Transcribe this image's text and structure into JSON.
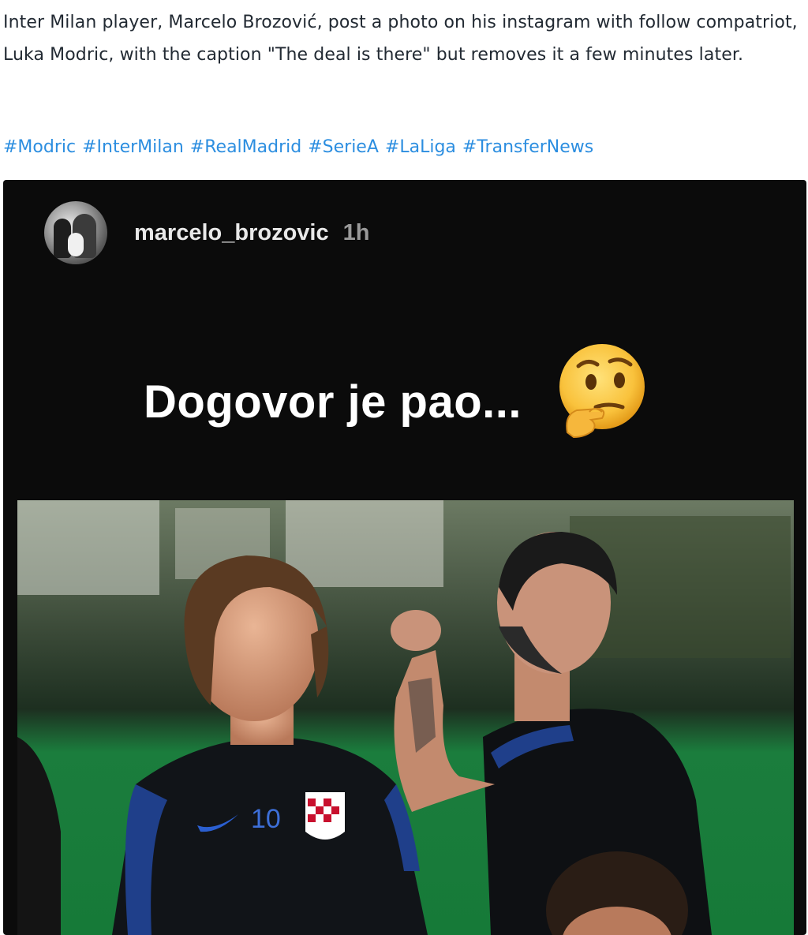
{
  "post": {
    "text": "Inter Milan player, Marcelo Brozović, post a photo on his instagram with follow compatriot, Luka Modric, with the caption \"The deal is there\" but removes it a few minutes later.",
    "hashtags": [
      "#Modric",
      "#InterMilan",
      "#RealMadrid",
      "#SerieA",
      "#LaLiga",
      "#TransferNews"
    ]
  },
  "story": {
    "username": "marcelo_brozovic",
    "time": "1h",
    "caption": "Dogovor je pao...",
    "emoji_icon": "thinking-face-icon"
  },
  "photo": {
    "jersey_number": "10"
  },
  "colors": {
    "hashtag": "#2c8ee0",
    "story_background": "#0b0b0b",
    "pitch_green": "#1a8a40"
  }
}
